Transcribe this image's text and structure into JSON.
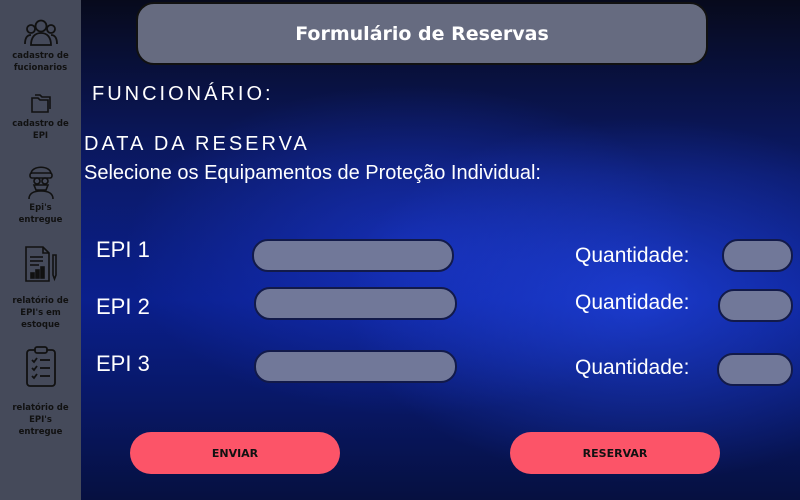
{
  "header": {
    "title": "Formulário de Reservas"
  },
  "sidebar": {
    "items": [
      {
        "label_1": "cadastro de",
        "label_2": "fucionarios",
        "icon": "users-icon"
      },
      {
        "label_1": "cadastro de",
        "label_2": "EPI",
        "icon": "folders-icon"
      },
      {
        "label_1": "Epi's",
        "label_2": "entregue",
        "icon": "protective-gear-icon"
      },
      {
        "label_1": "relatório de",
        "label_2": "EPI's em estoque",
        "icon": "report-chart-icon"
      },
      {
        "label_1": "relatório de EPI's",
        "label_2": "entregue",
        "icon": "clipboard-checklist-icon"
      }
    ]
  },
  "form": {
    "employee_label": "FUNCIONÁRIO:",
    "date_label": "DATA DA RESERVA",
    "instruction": "Selecione os Equipamentos de Proteção Individual:",
    "rows": [
      {
        "epi_label": "EPI 1",
        "qty_label": "Quantidade:",
        "epi_value": "",
        "qty_value": ""
      },
      {
        "epi_label": "EPI 2",
        "qty_label": "Quantidade:",
        "epi_value": "",
        "qty_value": ""
      },
      {
        "epi_label": "EPI 3",
        "qty_label": "Quantidade:",
        "epi_value": "",
        "qty_value": ""
      }
    ]
  },
  "actions": {
    "send_label": "ENVIAR",
    "reserve_label": "RESERVAR"
  },
  "colors": {
    "sidebar": "#454a5a",
    "button": "#fc5468",
    "field": "#717899",
    "header": "#666b80"
  }
}
